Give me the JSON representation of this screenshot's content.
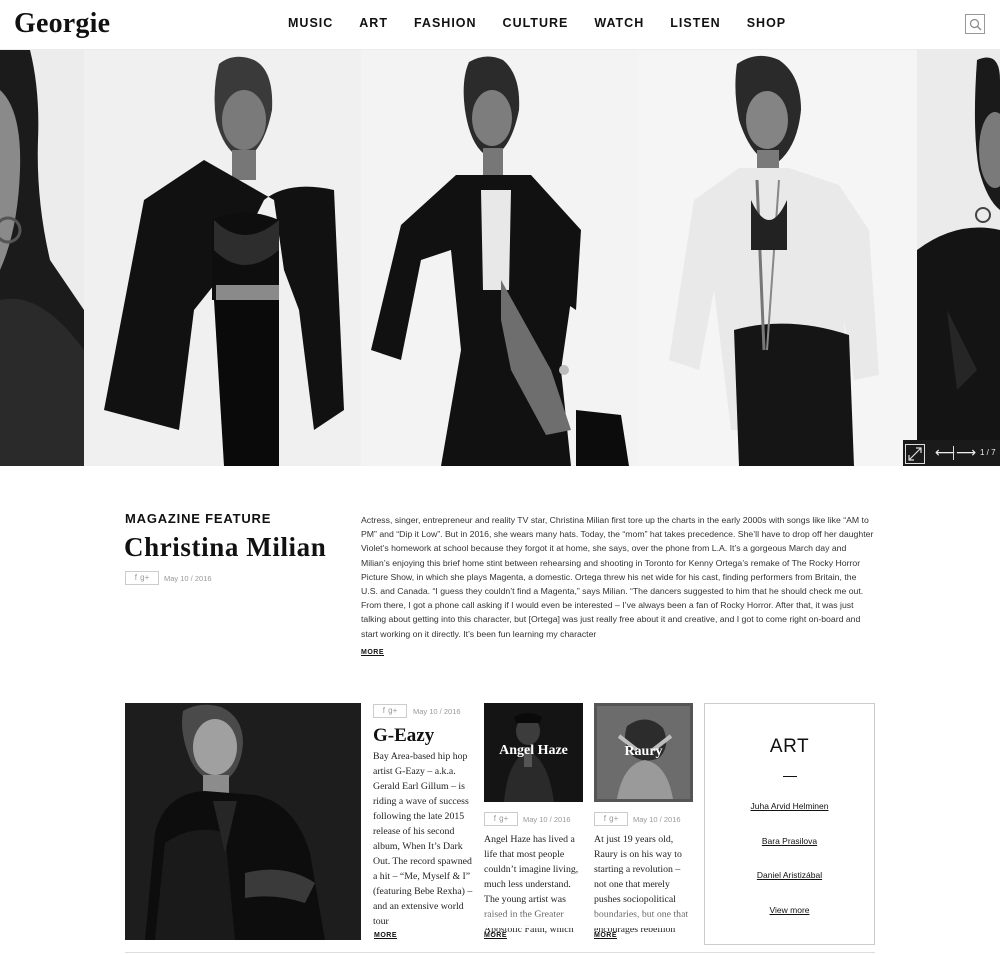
{
  "header": {
    "logo": "Georgie",
    "nav": [
      "MUSIC",
      "ART",
      "FASHION",
      "CULTURE",
      "WATCH",
      "LISTEN",
      "SHOP"
    ],
    "search_icon": "search-icon"
  },
  "gallery": {
    "counter": "1 / 7",
    "prev_icon": "arrow-left-icon",
    "next_icon": "arrow-right-icon",
    "expand_icon": "expand-icon"
  },
  "feature": {
    "kicker": "MAGAZINE FEATURE",
    "title": "Christina Milian",
    "share": "f  g+",
    "date": "May 10 / 2016",
    "body": "Actress, singer, entrepreneur and reality TV star, Christina Milian first tore up the charts in the early 2000s with songs like like “AM to PM” and “Dip it Low”. But in 2016, she wears many hats. Today, the “mom” hat takes precedence. She’ll have to drop off her daughter Violet’s homework at school because they forgot it at home, she says, over the phone from L.A. It’s a gorgeous March day and Milian’s enjoying this brief home stint between rehearsing and shooting in Toronto for Kenny Ortega’s remake of The Rocky Horror Picture Show, in which she plays Magenta, a domestic. Ortega threw his net wide for his cast, finding performers from Britain, the U.S. and Canada. “I guess they couldn’t find a Magenta,” says Milian. “The dancers suggested to him that he should check me out. From there, I got a phone call asking if I would even be interested – I’ve always been a fan of Rocky Horror. After that, it was just talking about getting into this character, but [Ortega] was just really free about it and creative, and I got to come right on-board and start working on it directly. It’s been fun learning my character",
    "more": "MORE"
  },
  "cards": [
    {
      "title": "G-Eazy",
      "share": "f  g+",
      "date": "May 10 / 2016",
      "text": "Bay Area-based hip hop artist G-Eazy – a.k.a. Gerald Earl Gillum – is riding a wave of success following the late 2015 release of his second album, When It’s Dark Out. The record spawned a hit – “Me, Myself & I” (featuring Bebe Rexha) – and an extensive world tour",
      "more": "MORE"
    },
    {
      "title": "Angel Haze",
      "share": "f  g+",
      "date": "May 10 / 2016",
      "text": "Angel Haze has lived a life that most people couldn’t imagine living, much less understand. The young artist was raised in the Greater Apostolic Faith, which",
      "more": "MORE"
    },
    {
      "title": "Raury",
      "share": "f  g+",
      "date": "May 10 / 2016",
      "text": "At just 19 years old, Raury is on his way to starting a revolution – not one that merely pushes sociopolitical boundaries, but one that encourages rebellion",
      "more": "MORE"
    }
  ],
  "art": {
    "title": "ART",
    "links": [
      "Juha Arvid Helminen",
      "Bara Prasilova",
      "Daniel Aristizábal"
    ],
    "view_more": "View more"
  }
}
